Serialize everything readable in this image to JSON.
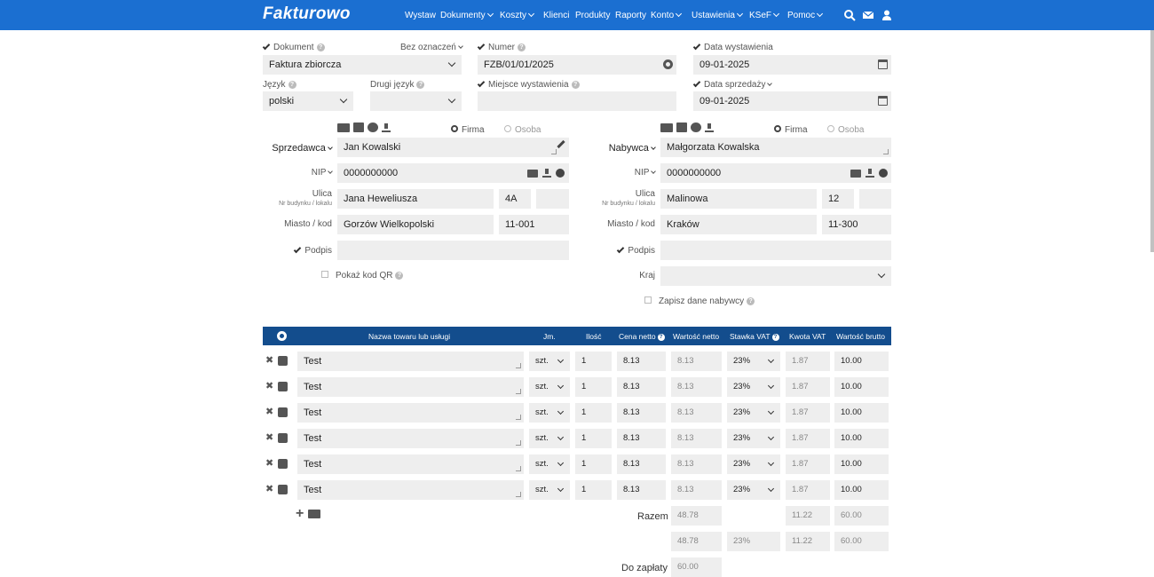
{
  "header": {
    "logo": "Fakturowo",
    "nav": [
      "Wystaw",
      "Dokumenty",
      "Koszty",
      "Klienci",
      "Produkty",
      "Raporty",
      "Konto",
      "Ustawienia",
      "KSeF",
      "Pomoc"
    ],
    "nav_dropdown": [
      false,
      true,
      true,
      false,
      false,
      false,
      true,
      true,
      true,
      true
    ],
    "icons": [
      "search-icon",
      "mail-icon",
      "user-icon"
    ]
  },
  "doc": {
    "dokument_label": "Dokument",
    "bez_oznaczen_label": "Bez oznaczeń",
    "dokument_value": "Faktura zbiorcza",
    "numer_label": "Numer",
    "numer_value": "FZB/01/01/2025",
    "data_wystawienia_label": "Data wystawienia",
    "data_wystawienia_value": "09-01-2025",
    "jezyk_label": "Język",
    "jezyk_value": "polski",
    "drugi_jezyk_label": "Drugi język",
    "drugi_jezyk_value": "",
    "miejsce_label": "Miejsce wystawienia",
    "miejsce_value": "",
    "data_sprzedazy_label": "Data sprzedaży",
    "data_sprzedazy_value": "09-01-2025"
  },
  "seller": {
    "role_label": "Sprzedawca",
    "firma_label": "Firma",
    "osoba_label": "Osoba",
    "name": "Jan Kowalski",
    "nip_label": "NIP",
    "nip": "0000000000",
    "ulica_label": "Ulica",
    "ulica_sub": "Nr budynku / lokalu",
    "street": "Jana Heweliusza",
    "building": "4A",
    "local": "",
    "miasto_label": "Miasto / kod",
    "city": "Gorzów Wielkopolski",
    "postcode": "11-001",
    "podpis_label": "Podpis",
    "podpis": "",
    "qr_label": "Pokaż kod QR"
  },
  "buyer": {
    "role_label": "Nabywca",
    "firma_label": "Firma",
    "osoba_label": "Osoba",
    "name": "Małgorzata Kowalska",
    "nip_label": "NIP",
    "nip": "0000000000",
    "ulica_label": "Ulica",
    "ulica_sub": "Nr budynku / lokalu",
    "street": "Malinowa",
    "building": "12",
    "local": "",
    "miasto_label": "Miasto / kod",
    "city": "Kraków",
    "postcode": "11-300",
    "podpis_label": "Podpis",
    "podpis": "",
    "kraj_label": "Kraj",
    "kraj": "",
    "zapisz_label": "Zapisz dane nabywcy"
  },
  "table": {
    "headers": {
      "name": "Nazwa towaru lub usługi",
      "jm": "Jm.",
      "ilosc": "Ilość",
      "cena_netto": "Cena netto",
      "wartosc_netto": "Wartość netto",
      "stawka_vat": "Stawka VAT",
      "kwota_vat": "Kwota VAT",
      "wartosc_brutto": "Wartość brutto"
    },
    "rows": [
      {
        "name": "Test",
        "jm": "szt.",
        "qty": "1",
        "price": "8.13",
        "net": "8.13",
        "vat": "23%",
        "vat_amount": "1.87",
        "gross": "10.00"
      },
      {
        "name": "Test",
        "jm": "szt.",
        "qty": "1",
        "price": "8.13",
        "net": "8.13",
        "vat": "23%",
        "vat_amount": "1.87",
        "gross": "10.00"
      },
      {
        "name": "Test",
        "jm": "szt.",
        "qty": "1",
        "price": "8.13",
        "net": "8.13",
        "vat": "23%",
        "vat_amount": "1.87",
        "gross": "10.00"
      },
      {
        "name": "Test",
        "jm": "szt.",
        "qty": "1",
        "price": "8.13",
        "net": "8.13",
        "vat": "23%",
        "vat_amount": "1.87",
        "gross": "10.00"
      },
      {
        "name": "Test",
        "jm": "szt.",
        "qty": "1",
        "price": "8.13",
        "net": "8.13",
        "vat": "23%",
        "vat_amount": "1.87",
        "gross": "10.00"
      },
      {
        "name": "Test",
        "jm": "szt.",
        "qty": "1",
        "price": "8.13",
        "net": "8.13",
        "vat": "23%",
        "vat_amount": "1.87",
        "gross": "10.00"
      }
    ],
    "razem_label": "Razem",
    "razem": {
      "net": "48.78",
      "vat_amount": "11.22",
      "gross": "60.00"
    },
    "vat_summary": {
      "net": "48.78",
      "rate": "23%",
      "vat_amount": "11.22",
      "gross": "60.00"
    },
    "do_zaplaty_label": "Do zapłaty",
    "do_zaplaty": "60.00"
  }
}
